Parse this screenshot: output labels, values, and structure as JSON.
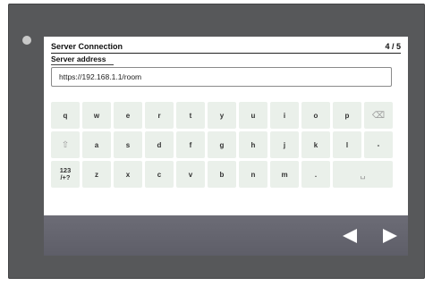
{
  "dialog": {
    "title": "Server Connection",
    "page_indicator": "4 / 5"
  },
  "address": {
    "label": "Server address",
    "value": "https://192.168.1.1/room"
  },
  "keyboard": {
    "rows": [
      [
        {
          "label": "q",
          "name": "key-q"
        },
        {
          "label": "w",
          "name": "key-w"
        },
        {
          "label": "e",
          "name": "key-e"
        },
        {
          "label": "r",
          "name": "key-r"
        },
        {
          "label": "t",
          "name": "key-t"
        },
        {
          "label": "y",
          "name": "key-y"
        },
        {
          "label": "u",
          "name": "key-u"
        },
        {
          "label": "i",
          "name": "key-i"
        },
        {
          "label": "o",
          "name": "key-o"
        },
        {
          "label": "p",
          "name": "key-p"
        },
        {
          "label": "⌫",
          "name": "backspace-icon",
          "icon": true
        }
      ],
      [
        {
          "label": "⇧",
          "name": "shift-icon",
          "icon": true
        },
        {
          "label": "a",
          "name": "key-a"
        },
        {
          "label": "s",
          "name": "key-s"
        },
        {
          "label": "d",
          "name": "key-d"
        },
        {
          "label": "f",
          "name": "key-f"
        },
        {
          "label": "g",
          "name": "key-g"
        },
        {
          "label": "h",
          "name": "key-h"
        },
        {
          "label": "j",
          "name": "key-j"
        },
        {
          "label": "k",
          "name": "key-k"
        },
        {
          "label": "l",
          "name": "key-l"
        },
        {
          "label": "-",
          "name": "key-hyphen"
        }
      ],
      [
        {
          "label": "123\n/+?",
          "name": "key-numbers-symbols",
          "num": true
        },
        {
          "label": "z",
          "name": "key-z"
        },
        {
          "label": "x",
          "name": "key-x"
        },
        {
          "label": "c",
          "name": "key-c"
        },
        {
          "label": "v",
          "name": "key-v"
        },
        {
          "label": "b",
          "name": "key-b"
        },
        {
          "label": "n",
          "name": "key-n"
        },
        {
          "label": "m",
          "name": "key-m"
        },
        {
          "label": ".",
          "name": "key-period"
        },
        {
          "label": "␣",
          "name": "space-icon",
          "icon": true,
          "wide": true
        }
      ]
    ]
  },
  "navigation": {
    "prev_icon": "left-triangle-icon",
    "next_icon": "right-triangle-icon"
  },
  "colors": {
    "bezel": "#57585a",
    "key_bg": "#eaf0ea",
    "footer": "#65656f"
  }
}
